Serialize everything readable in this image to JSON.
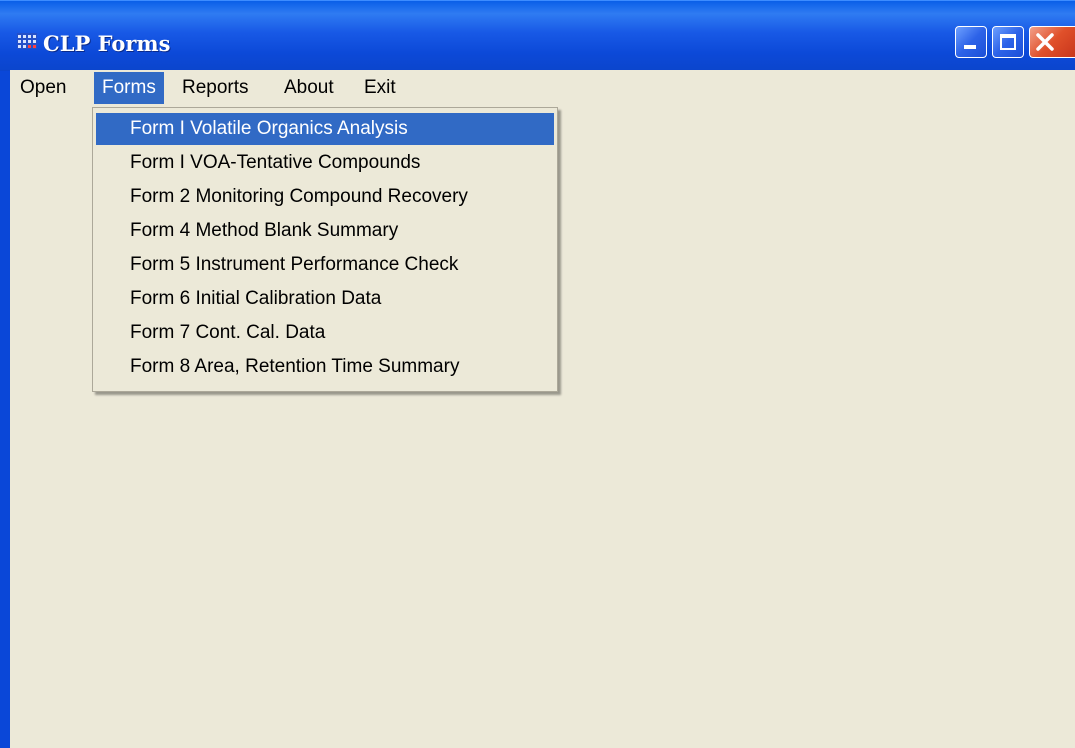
{
  "window": {
    "title": "CLP Forms",
    "icon": "app-grid-icon",
    "buttons": {
      "minimize": "minimize-icon",
      "maximize": "maximize-icon",
      "close": "close-icon"
    }
  },
  "menubar": {
    "items": [
      {
        "label": "Open"
      },
      {
        "label": "Forms",
        "active": true
      },
      {
        "label": "Reports"
      },
      {
        "label": "About"
      },
      {
        "label": "Exit"
      }
    ]
  },
  "forms_menu": {
    "items": [
      {
        "label": "Form I Volatile Organics Analysis",
        "highlighted": true
      },
      {
        "label": "Form I VOA-Tentative Compounds"
      },
      {
        "label": "Form 2 Monitoring Compound Recovery"
      },
      {
        "label": "Form 4 Method Blank Summary"
      },
      {
        "label": "Form 5 Instrument Performance Check"
      },
      {
        "label": "Form 6 Initial Calibration Data"
      },
      {
        "label": "Form 7 Cont. Cal. Data"
      },
      {
        "label": "Form 8 Area, Retention Time Summary"
      }
    ]
  },
  "colors": {
    "titlebar": "#0c49d8",
    "client_bg": "#ece9d8",
    "highlight": "#316ac5",
    "close_button": "#e0502a"
  }
}
